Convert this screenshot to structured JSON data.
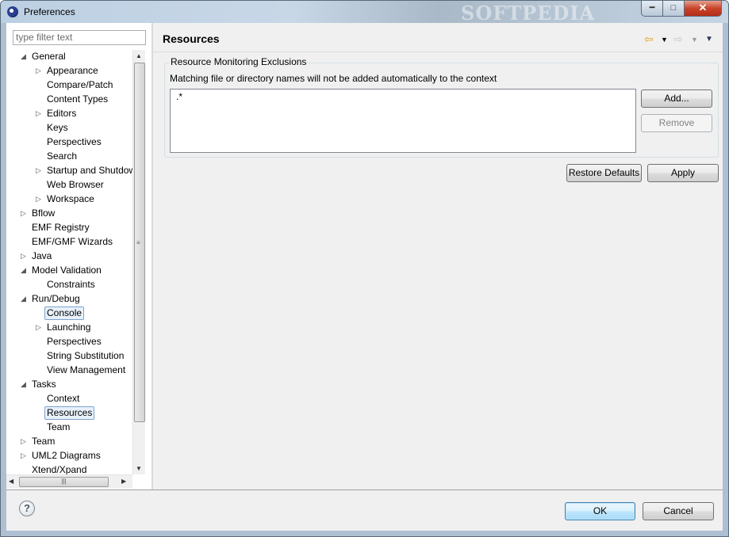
{
  "window": {
    "title": "Preferences",
    "watermark": "SOFTPEDIA"
  },
  "filter": {
    "placeholder": "type filter text"
  },
  "tree": {
    "items": [
      {
        "label": "General",
        "level": 0,
        "expander": "open"
      },
      {
        "label": "Appearance",
        "level": 1,
        "expander": "closed"
      },
      {
        "label": "Compare/Patch",
        "level": 1,
        "expander": "none"
      },
      {
        "label": "Content Types",
        "level": 1,
        "expander": "none"
      },
      {
        "label": "Editors",
        "level": 1,
        "expander": "closed"
      },
      {
        "label": "Keys",
        "level": 1,
        "expander": "none"
      },
      {
        "label": "Perspectives",
        "level": 1,
        "expander": "none"
      },
      {
        "label": "Search",
        "level": 1,
        "expander": "none"
      },
      {
        "label": "Startup and Shutdown",
        "level": 1,
        "expander": "closed"
      },
      {
        "label": "Web Browser",
        "level": 1,
        "expander": "none"
      },
      {
        "label": "Workspace",
        "level": 1,
        "expander": "closed"
      },
      {
        "label": "Bflow",
        "level": 0,
        "expander": "closed"
      },
      {
        "label": "EMF Registry",
        "level": 0,
        "expander": "none"
      },
      {
        "label": "EMF/GMF Wizards",
        "level": 0,
        "expander": "none"
      },
      {
        "label": "Java",
        "level": 0,
        "expander": "closed"
      },
      {
        "label": "Model Validation",
        "level": 0,
        "expander": "open"
      },
      {
        "label": "Constraints",
        "level": 1,
        "expander": "none"
      },
      {
        "label": "Run/Debug",
        "level": 0,
        "expander": "open"
      },
      {
        "label": "Console",
        "level": 1,
        "expander": "none",
        "state": "outlined"
      },
      {
        "label": "Launching",
        "level": 1,
        "expander": "closed"
      },
      {
        "label": "Perspectives",
        "level": 1,
        "expander": "none"
      },
      {
        "label": "String Substitution",
        "level": 1,
        "expander": "none"
      },
      {
        "label": "View Management",
        "level": 1,
        "expander": "none"
      },
      {
        "label": "Tasks",
        "level": 0,
        "expander": "open"
      },
      {
        "label": "Context",
        "level": 1,
        "expander": "none"
      },
      {
        "label": "Resources",
        "level": 1,
        "expander": "none",
        "state": "selected"
      },
      {
        "label": "Team",
        "level": 1,
        "expander": "none"
      },
      {
        "label": "Team",
        "level": 0,
        "expander": "closed"
      },
      {
        "label": "UML2 Diagrams",
        "level": 0,
        "expander": "closed"
      },
      {
        "label": "Xtend/Xpand",
        "level": 0,
        "expander": "none"
      }
    ]
  },
  "page": {
    "title": "Resources",
    "group_title": "Resource Monitoring Exclusions",
    "description": "Matching file or directory names will not be added automatically to the context",
    "exclusions": [
      ".*"
    ],
    "add_label": "Add...",
    "remove_label": "Remove",
    "restore_label": "Restore Defaults",
    "apply_label": "Apply"
  },
  "footer": {
    "help_symbol": "?",
    "ok_label": "OK",
    "cancel_label": "Cancel"
  },
  "icons": {
    "back": "back-arrow-icon",
    "forward": "forward-arrow-icon",
    "menu": "view-menu-icon",
    "help": "help-icon"
  },
  "colors": {
    "accent": "#3c7fb1",
    "selection": "#e8f1fb",
    "back_arrow": "#e8a020"
  }
}
